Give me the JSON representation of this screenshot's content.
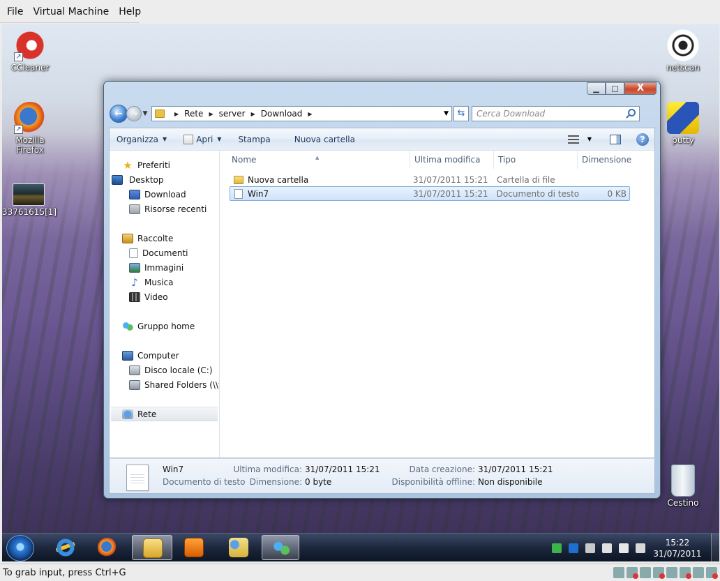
{
  "host": {
    "menu": [
      "File",
      "Virtual Machine",
      "Help"
    ],
    "status_text": "To grab input, press Ctrl+G"
  },
  "desktop_icons": {
    "ccleaner": "CCleaner",
    "firefox_line1": "Mozilla",
    "firefox_line2": "Firefox",
    "image_file": "33761615[1]",
    "netscan": "netscan",
    "putty": "putty",
    "recycle_bin": "Cestino"
  },
  "explorer": {
    "caption_buttons": {
      "minimize": "▁",
      "maximize": "□",
      "close": "X"
    },
    "address": {
      "crumbs": [
        "Rete",
        "server",
        "Download"
      ]
    },
    "search_placeholder": "Cerca Download",
    "toolbar": {
      "organize": "Organizza",
      "open": "Apri",
      "print": "Stampa",
      "new_folder": "Nuova cartella",
      "help": "?"
    },
    "nav": {
      "favorites": "Preferiti",
      "desktop": "Desktop",
      "download": "Download",
      "recent": "Risorse recenti",
      "libraries": "Raccolte",
      "documents": "Documenti",
      "pictures": "Immagini",
      "music": "Musica",
      "video": "Video",
      "homegroup": "Gruppo home",
      "computer": "Computer",
      "local_disk": "Disco locale (C:)",
      "shared_folders": "Shared Folders (\\\\vmware-host)",
      "network": "Rete"
    },
    "columns": [
      "Nome",
      "Ultima modifica",
      "Tipo",
      "Dimensione"
    ],
    "files": [
      {
        "name": "Nuova cartella",
        "modified": "31/07/2011 15:21",
        "type": "Cartella di file",
        "size": ""
      },
      {
        "name": "Win7",
        "modified": "31/07/2011 15:21",
        "type": "Documento di testo",
        "size": "0 KB"
      }
    ],
    "details": {
      "name": "Win7",
      "kind": "Documento di testo",
      "modified_label": "Ultima modifica:",
      "modified_value": "31/07/2011 15:21",
      "size_label": "Dimensione:",
      "size_value": "0 byte",
      "created_label": "Data creazione:",
      "created_value": "31/07/2011 15:21",
      "offline_label": "Disponibilità offline:",
      "offline_value": "Non disponibile"
    }
  },
  "taskbar": {
    "time": "15:22",
    "date": "31/07/2011"
  },
  "colors": {
    "window_glass": "#b9cfe7",
    "selection": "#cfe3fb",
    "selection_border": "#84acdd",
    "taskbar": "#1a2a40"
  }
}
